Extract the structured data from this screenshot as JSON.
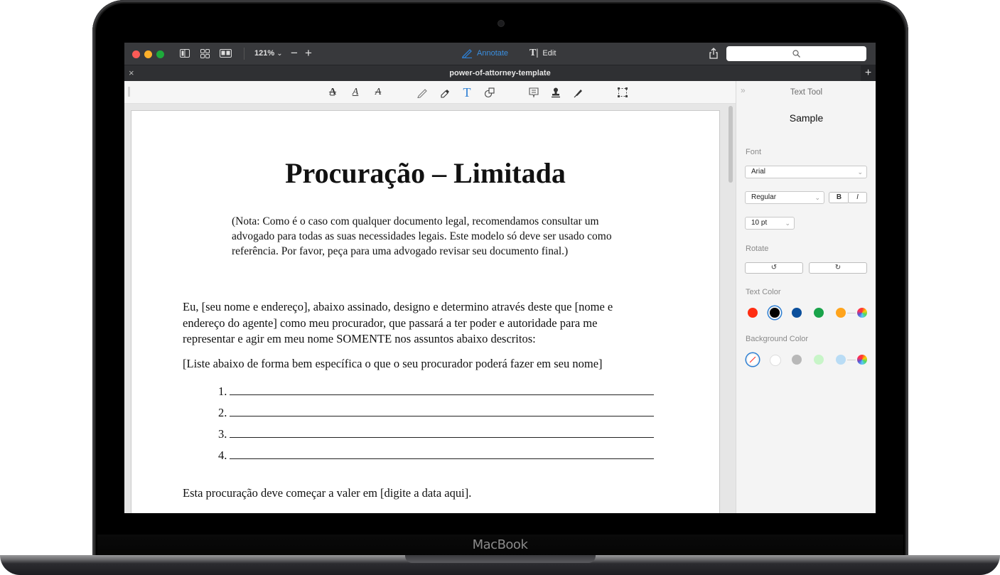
{
  "device": {
    "brand": "MacBook"
  },
  "window": {
    "zoom_level": "121%",
    "modes": [
      {
        "label": "Annotate",
        "icon": "annotate-pen-icon",
        "active": true
      },
      {
        "label": "Edit",
        "icon": "text-cursor-icon",
        "active": false
      }
    ],
    "search": {
      "placeholder": "",
      "icon": "search-icon"
    },
    "document_title": "power-of-attorney-template"
  },
  "annotation_tools": [
    "text-highlight-icon",
    "underline-icon",
    "strikethrough-icon",
    "pencil-icon",
    "eraser-icon",
    "text-tool-icon",
    "shapes-icon",
    "note-icon",
    "stamp-icon",
    "signature-pen-icon",
    "selection-icon"
  ],
  "document": {
    "title": "Procuração – Limitada",
    "note": "(Nota: Como é o caso com qualquer documento legal, recomendamos consultar um advogado para todas as suas necessidades legais. Este modelo só deve ser usado como referência. Por favor, peça para uma advogado revisar seu documento final.)",
    "paragraph1": "Eu, [seu nome e endereço], abaixo assinado, designo e determino através deste que [nome e endereço do agente] como meu procurador, que passará a ter poder e autoridade para me representar e agir em meu nome SOMENTE nos assuntos abaixo descritos:",
    "paragraph2": "[Liste abaixo de forma bem específica o que o seu procurador poderá fazer em seu nome]",
    "list": [
      "1.",
      "2.",
      "3.",
      "4."
    ],
    "paragraph3": "Esta procuração deve começar a valer em [digite a data aqui]."
  },
  "sidebar": {
    "title": "Text Tool",
    "sample": "Sample",
    "font_label": "Font",
    "font_value": "Arial",
    "style_value": "Regular",
    "bold_label": "B",
    "italic_label": "I",
    "size_value": "10 pt",
    "rotate_label": "Rotate",
    "text_color_label": "Text Color",
    "text_colors": [
      "#ff2d12",
      "#000000",
      "#0b4f9c",
      "#19a34a",
      "#ffa41c"
    ],
    "text_color_selected": 1,
    "background_color_label": "Background Color",
    "background_colors": [
      "none",
      "#ffffff",
      "#b8b8b8",
      "#c8f5c8",
      "#b9dcf5"
    ],
    "background_color_selected": 0
  }
}
